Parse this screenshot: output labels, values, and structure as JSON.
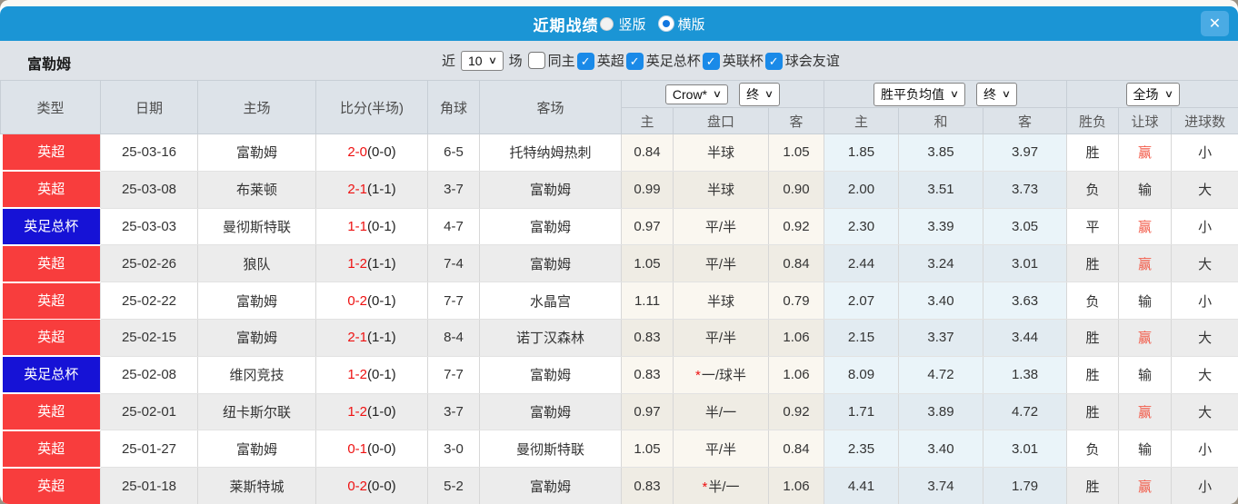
{
  "titlebar": {
    "title": "近期战绩",
    "view_options": [
      {
        "label": "竖版",
        "selected": false
      },
      {
        "label": "横版",
        "selected": true
      }
    ]
  },
  "icons": {
    "close": "✕",
    "check": "✓",
    "chevron_down": "∨"
  },
  "filter": {
    "team": "富勒姆",
    "near_label": "近",
    "count_value": "10",
    "games_label": "场",
    "same_home_label": "同主",
    "same_home_checked": false,
    "leagues": [
      {
        "label": "英超",
        "checked": true
      },
      {
        "label": "英足总杯",
        "checked": true
      },
      {
        "label": "英联杯",
        "checked": true
      },
      {
        "label": "球会友谊",
        "checked": true
      }
    ]
  },
  "table": {
    "headers": {
      "type": "类型",
      "date": "日期",
      "home": "主场",
      "score": "比分(半场)",
      "corner": "角球",
      "away": "客场"
    },
    "selects": {
      "bookmaker": "Crow*",
      "final1": "终",
      "avg": "胜平负均值",
      "final2": "终",
      "fullmatch": "全场"
    },
    "subheaders": [
      "主",
      "盘口",
      "客",
      "主",
      "和",
      "客",
      "胜负",
      "让球",
      "进球数"
    ],
    "league_colors": {
      "英超": "#f83d3d",
      "英足总杯": "#1612d6"
    },
    "rows": [
      {
        "league": "英超",
        "date": "25-03-16",
        "home": "富勒姆",
        "hf": true,
        "score": "2-0",
        "half": "(0-0)",
        "corner": "6-5",
        "away": "托特纳姆热刺",
        "af": false,
        "o1": "0.84",
        "star": false,
        "hc": "半球",
        "o2": "1.05",
        "a1": "1.85",
        "a2": "3.85",
        "a3": "3.97",
        "res": [
          "胜",
          "r"
        ],
        "let": [
          "赢",
          "r"
        ],
        "goal": [
          "小",
          "g"
        ]
      },
      {
        "league": "英超",
        "date": "25-03-08",
        "home": "布莱顿",
        "hf": false,
        "score": "2-1",
        "half": "(1-1)",
        "corner": "3-7",
        "away": "富勒姆",
        "af": true,
        "o1": "0.99",
        "star": false,
        "hc": "半球",
        "o2": "0.90",
        "a1": "2.00",
        "a2": "3.51",
        "a3": "3.73",
        "res": [
          "负",
          "g"
        ],
        "let": [
          "输",
          "g"
        ],
        "goal": [
          "大",
          "r"
        ]
      },
      {
        "league": "英足总杯",
        "date": "25-03-03",
        "home": "曼彻斯特联",
        "hf": false,
        "score": "1-1",
        "half": "(0-1)",
        "corner": "4-7",
        "away": "富勒姆",
        "af": true,
        "o1": "0.97",
        "star": false,
        "hc": "平/半",
        "o2": "0.92",
        "a1": "2.30",
        "a2": "3.39",
        "a3": "3.05",
        "res": [
          "平",
          "b"
        ],
        "let": [
          "赢",
          "r"
        ],
        "goal": [
          "小",
          "g"
        ]
      },
      {
        "league": "英超",
        "date": "25-02-26",
        "home": "狼队",
        "hf": false,
        "score": "1-2",
        "half": "(1-1)",
        "corner": "7-4",
        "away": "富勒姆",
        "af": true,
        "o1": "1.05",
        "star": false,
        "hc": "平/半",
        "o2": "0.84",
        "a1": "2.44",
        "a2": "3.24",
        "a3": "3.01",
        "res": [
          "胜",
          "r"
        ],
        "let": [
          "赢",
          "r"
        ],
        "goal": [
          "大",
          "r"
        ]
      },
      {
        "league": "英超",
        "date": "25-02-22",
        "home": "富勒姆",
        "hf": true,
        "score": "0-2",
        "half": "(0-1)",
        "corner": "7-7",
        "away": "水晶宫",
        "af": false,
        "o1": "1.11",
        "star": false,
        "hc": "半球",
        "o2": "0.79",
        "a1": "2.07",
        "a2": "3.40",
        "a3": "3.63",
        "res": [
          "负",
          "g"
        ],
        "let": [
          "输",
          "g"
        ],
        "goal": [
          "小",
          "g"
        ]
      },
      {
        "league": "英超",
        "date": "25-02-15",
        "home": "富勒姆",
        "hf": true,
        "score": "2-1",
        "half": "(1-1)",
        "corner": "8-4",
        "away": "诺丁汉森林",
        "af": false,
        "o1": "0.83",
        "star": false,
        "hc": "平/半",
        "o2": "1.06",
        "a1": "2.15",
        "a2": "3.37",
        "a3": "3.44",
        "res": [
          "胜",
          "r"
        ],
        "let": [
          "赢",
          "r"
        ],
        "goal": [
          "大",
          "r"
        ]
      },
      {
        "league": "英足总杯",
        "date": "25-02-08",
        "home": "维冈竞技",
        "hf": false,
        "score": "1-2",
        "half": "(0-1)",
        "corner": "7-7",
        "away": "富勒姆",
        "af": true,
        "o1": "0.83",
        "star": true,
        "hc": "一/球半",
        "o2": "1.06",
        "a1": "8.09",
        "a2": "4.72",
        "a3": "1.38",
        "res": [
          "胜",
          "r"
        ],
        "let": [
          "输",
          "g"
        ],
        "goal": [
          "大",
          "r"
        ]
      },
      {
        "league": "英超",
        "date": "25-02-01",
        "home": "纽卡斯尔联",
        "hf": false,
        "score": "1-2",
        "half": "(1-0)",
        "corner": "3-7",
        "away": "富勒姆",
        "af": true,
        "o1": "0.97",
        "star": false,
        "hc": "半/一",
        "o2": "0.92",
        "a1": "1.71",
        "a2": "3.89",
        "a3": "4.72",
        "res": [
          "胜",
          "r"
        ],
        "let": [
          "赢",
          "r"
        ],
        "goal": [
          "大",
          "r"
        ]
      },
      {
        "league": "英超",
        "date": "25-01-27",
        "home": "富勒姆",
        "hf": true,
        "score": "0-1",
        "half": "(0-0)",
        "corner": "3-0",
        "away": "曼彻斯特联",
        "af": false,
        "o1": "1.05",
        "star": false,
        "hc": "平/半",
        "o2": "0.84",
        "a1": "2.35",
        "a2": "3.40",
        "a3": "3.01",
        "res": [
          "负",
          "g"
        ],
        "let": [
          "输",
          "g"
        ],
        "goal": [
          "小",
          "g"
        ]
      },
      {
        "league": "英超",
        "date": "25-01-18",
        "home": "莱斯特城",
        "hf": false,
        "score": "0-2",
        "half": "(0-0)",
        "corner": "5-2",
        "away": "富勒姆",
        "af": true,
        "o1": "0.83",
        "star": true,
        "hc": "半/一",
        "o2": "1.06",
        "a1": "4.41",
        "a2": "3.74",
        "a3": "1.79",
        "res": [
          "胜",
          "r"
        ],
        "let": [
          "赢",
          "r"
        ],
        "goal": [
          "小",
          "g"
        ]
      }
    ]
  },
  "colors": {
    "titlebar_bg": "#1b95d5",
    "close_btn_bg": "#4aabe4",
    "radio_dot": "#1377e0",
    "filter_bg": "#dfe3e8",
    "header_bg": "#dde3e9",
    "checkbox_blue": "#1a8ae8",
    "focus_team_green": "#3e8a4b",
    "score_red": "#ee1111",
    "win_red": "#f23c3c",
    "lose_green": "#4e8e4e",
    "draw_blue": "#4343ea",
    "crow_col_bg": "#faf7f0",
    "avg_col_bg": "#eaf4f9"
  }
}
